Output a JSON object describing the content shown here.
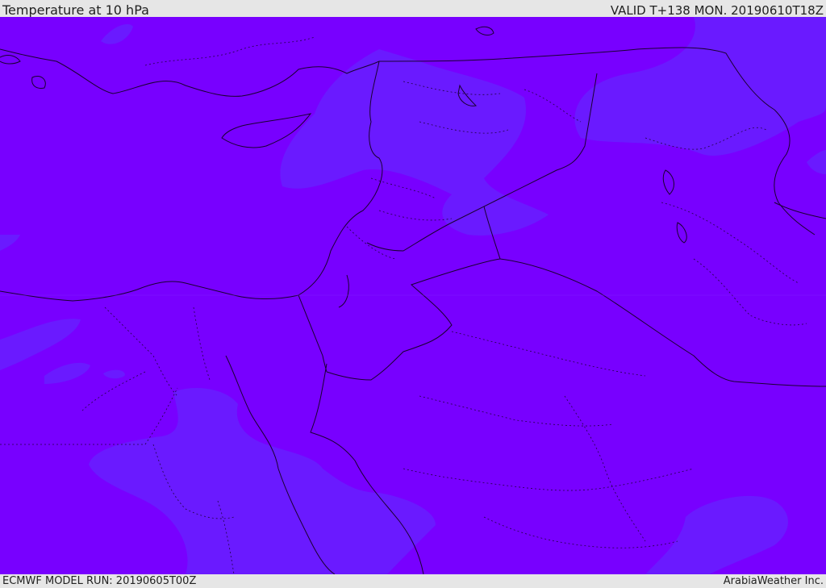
{
  "header": {
    "title": "Temperature at 10 hPa",
    "valid_time": "VALID T+138 MON. 20190610T18Z"
  },
  "footer": {
    "model_run": "ECMWF MODEL RUN: 20190605T00Z",
    "credit": "ArabiaWeather Inc."
  },
  "map": {
    "colors": {
      "background": "#7800ff",
      "warm_band": "#6a1aff",
      "coastline": "#1a0030",
      "border": "#1a0030"
    }
  }
}
